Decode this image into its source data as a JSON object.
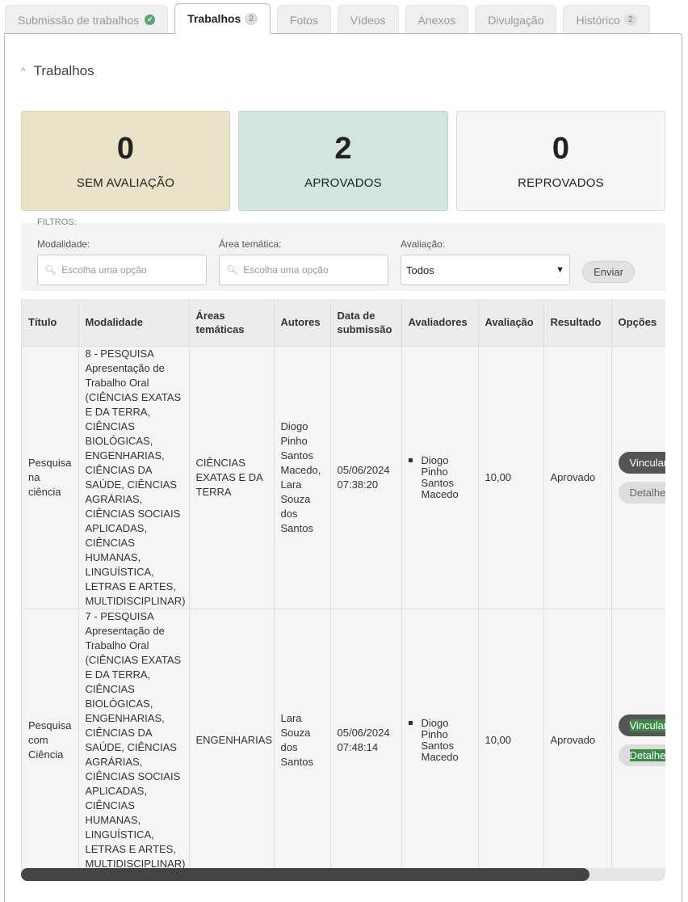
{
  "tabs": [
    {
      "label": "Submissão de trabalhos",
      "count": "",
      "checked": true
    },
    {
      "label": "Trabalhos",
      "count": "2",
      "active": true
    },
    {
      "label": "Fotos",
      "count": ""
    },
    {
      "label": "Vídeos",
      "count": ""
    },
    {
      "label": "Anexos",
      "count": ""
    },
    {
      "label": "Divulgação",
      "count": ""
    },
    {
      "label": "Histórico",
      "count": "2"
    }
  ],
  "section": {
    "title": "Trabalhos",
    "chevron": "^"
  },
  "stats": [
    {
      "value": "0",
      "label": "SEM AVALIAÇÃO"
    },
    {
      "value": "2",
      "label": "APROVADOS"
    },
    {
      "value": "0",
      "label": "REPROVADOS"
    }
  ],
  "filters": {
    "title": "FILTROS:",
    "modalidade_label": "Modalidade:",
    "modalidade_placeholder": "Escolha uma opção",
    "area_label": "Área temática:",
    "area_placeholder": "Escolha uma opção",
    "avaliacao_label": "Avaliação:",
    "avaliacao_value": "Todos",
    "send_label": "Enviar"
  },
  "table": {
    "headers": [
      "Título",
      "Modalidade",
      "Áreas temáticas",
      "Autores",
      "Data de submissão",
      "Avaliadores",
      "Avaliação",
      "Resultado",
      "Opções"
    ],
    "rows": [
      {
        "titulo": "Pesquisa na ciência",
        "modalidade": "8 - PESQUISA Apresentação de Trabalho Oral (CIÊNCIAS EXATAS E DA TERRA, CIÊNCIAS BIOLÓGICAS, ENGENHARIAS, CIÊNCIAS DA SAÚDE, CIÊNCIAS AGRÁRIAS, CIÊNCIAS SOCIAIS APLICADAS, CIÊNCIAS HUMANAS, LINGUÍSTICA, LETRAS E ARTES, MULTIDISCIPLINAR)",
        "areas": "CIÊNCIAS EXATAS E DA TERRA",
        "autores": "Diogo Pinho Santos Macedo, Lara Souza dos Santos",
        "data": "05/06/2024 07:38:20",
        "avaliadores": [
          "Diogo Pinho Santos Macedo"
        ],
        "avaliacao": "10,00",
        "resultado": "Aprovado",
        "opcoes": [
          "Vincular",
          "Detalhes"
        ]
      },
      {
        "titulo": "Pesquisa com Ciência",
        "modalidade": "7 - PESQUISA Apresentação de Trabalho Oral (CIÊNCIAS EXATAS E DA TERRA, CIÊNCIAS BIOLÓGICAS, ENGENHARIAS, CIÊNCIAS DA SAÚDE, CIÊNCIAS AGRÁRIAS, CIÊNCIAS SOCIAIS APLICADAS, CIÊNCIAS HUMANAS, LINGUÍSTICA, LETRAS E ARTES, MULTIDISCIPLINAR)",
        "areas": "ENGENHARIAS",
        "autores": "Lara Souza dos Santos",
        "data": "05/06/2024 07:48:14",
        "avaliadores": [
          "Diogo Pinho Santos Macedo"
        ],
        "avaliacao": "10,00",
        "resultado": "Aprovado",
        "opcoes": [
          "Vincular",
          "Detalhes"
        ]
      }
    ]
  },
  "colors": {
    "accent_green": "#5aa56f",
    "highlight": "#3c8a4a",
    "sem_avaliacao_bg": "#ebe3c9",
    "aprovados_bg": "#d2e6df"
  }
}
